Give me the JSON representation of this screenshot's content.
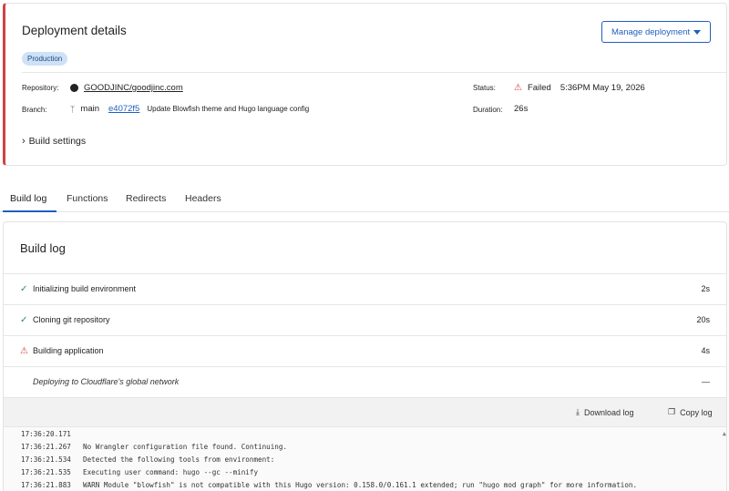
{
  "deployment": {
    "title": "Deployment details",
    "environment_badge": "Production",
    "manage_button": "Manage deployment",
    "repository_label": "Repository:",
    "repository": "GOODJINC/goodjinc.com",
    "branch_label": "Branch:",
    "branch": "main",
    "commit": "e4072f5",
    "commit_message": "Update Blowfish theme and Hugo language config",
    "status_label": "Status:",
    "status": "Failed",
    "status_time": "5:36PM May 19, 2026",
    "duration_label": "Duration:",
    "duration": "26s",
    "build_settings": "Build settings",
    "status_color": "#d14343"
  },
  "tabs": [
    {
      "label": "Build log",
      "active": true
    },
    {
      "label": "Functions"
    },
    {
      "label": "Redirects"
    },
    {
      "label": "Headers"
    }
  ],
  "build_log": {
    "title": "Build log",
    "steps": [
      {
        "label": "Initializing build environment",
        "duration": "2s",
        "status": "success"
      },
      {
        "label": "Cloning git repository",
        "duration": "20s",
        "status": "success"
      },
      {
        "label": "Building application",
        "duration": "4s",
        "status": "failed"
      },
      {
        "label": "Deploying to Cloudflare's global network",
        "duration": "—",
        "status": "pending"
      }
    ],
    "download_log": "Download log",
    "copy_log": "Copy log",
    "lines": [
      {
        "time": "17:36:20.171",
        "text": ""
      },
      {
        "time": "17:36:21.267",
        "text": "No Wrangler configuration file found. Continuing."
      },
      {
        "time": "17:36:21.534",
        "text": "Detected the following tools from environment:"
      },
      {
        "time": "17:36:21.535",
        "text": "Executing user command: hugo --gc --minify"
      },
      {
        "time": "17:36:21.883",
        "text": "WARN  Module \"blowfish\" is not compatible with this Hugo version: 0.158.0/0.161.1 extended; run \"hugo mod graph\" for more information."
      }
    ]
  },
  "icons": {
    "github": "github-icon",
    "branch": "git-branch-icon",
    "warning": "warning-triangle-icon",
    "check": "check-icon",
    "download": "download-icon",
    "copy": "copy-icon"
  },
  "accent_color": "#1f5fbf"
}
